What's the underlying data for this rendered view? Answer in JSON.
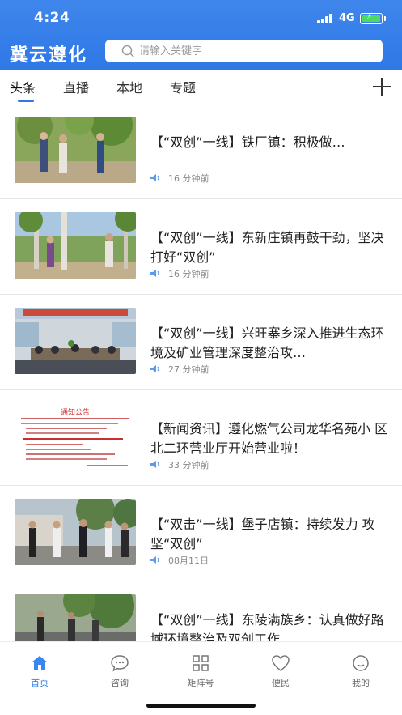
{
  "status_bar": {
    "time": "4:24",
    "network": "4G"
  },
  "header": {
    "app_title": "冀云遵化",
    "search": {
      "placeholder": "请输入关键字"
    }
  },
  "tabs": [
    {
      "label": "头条",
      "active": true
    },
    {
      "label": "直播",
      "active": false
    },
    {
      "label": "本地",
      "active": false
    },
    {
      "label": "专题",
      "active": false
    }
  ],
  "feed": [
    {
      "title": "【“双创”一线】铁厂镇：积极做…",
      "time": "16 分钟前"
    },
    {
      "title": "【“双创”一线】东新庄镇再鼓干劲，坚决打好“双创”",
      "time": "16 分钟前"
    },
    {
      "title": "【“双创”一线】兴旺寨乡深入推进生态环境及矿业管理深度整治攻…",
      "time": "27 分钟前"
    },
    {
      "title": "【新闻资讯】遵化燃气公司龙华名苑小 区北二环营业厅开始营业啦！",
      "time": "33 分钟前",
      "thumb_heading": "通知公告"
    },
    {
      "title": "【“双击”一线】堡子店镇：持续发力 攻坚“双创”",
      "time": "08月11日"
    },
    {
      "title": "【“双创”一线】东陵满族乡：认真做好路域环境整治及双创工作",
      "time": ""
    }
  ],
  "bottom_nav": [
    {
      "label": "首页",
      "icon": "home-icon",
      "active": true
    },
    {
      "label": "咨询",
      "icon": "chat-icon",
      "active": false
    },
    {
      "label": "矩阵号",
      "icon": "grid-icon",
      "active": false
    },
    {
      "label": "便民",
      "icon": "heart-icon",
      "active": false
    },
    {
      "label": "我的",
      "icon": "profile-icon",
      "active": false
    }
  ],
  "colors": {
    "accent": "#2f78e6",
    "header": "#3f86ec",
    "battery": "#4cd964"
  }
}
